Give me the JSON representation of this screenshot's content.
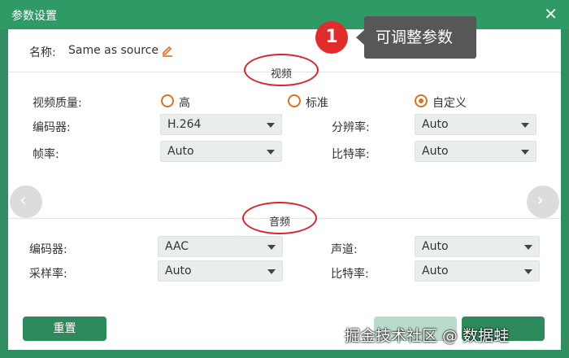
{
  "window": {
    "title": "参数设置",
    "close_glyph": "✕"
  },
  "name": {
    "label": "名称:",
    "value": "Same as source",
    "edit_icon": "pencil-icon"
  },
  "callout": {
    "number": "1",
    "text": "可调整参数"
  },
  "video": {
    "section_title": "视频",
    "quality_label": "视频质量:",
    "quality_options": [
      {
        "label": "高",
        "checked": false
      },
      {
        "label": "标准",
        "checked": false
      },
      {
        "label": "自定义",
        "checked": true
      }
    ],
    "encoder_label": "编码器:",
    "encoder_value": "H.264",
    "resolution_label": "分辨率:",
    "resolution_value": "Auto",
    "framerate_label": "帧率:",
    "framerate_value": "Auto",
    "bitrate_label": "比特率:",
    "bitrate_value": "Auto"
  },
  "audio": {
    "section_title": "音频",
    "encoder_label": "编码器:",
    "encoder_value": "AAC",
    "channel_label": "声道:",
    "channel_value": "Auto",
    "samplerate_label": "采样率:",
    "samplerate_value": "Auto",
    "bitrate_label": "比特率:",
    "bitrate_value": "Auto"
  },
  "nav": {
    "prev_glyph": "‹",
    "next_glyph": "›"
  },
  "footer": {
    "reset_label": "重置"
  },
  "watermark": "掘金技术社区 @ 数据蛙",
  "colors": {
    "accent": "#2e8a5c",
    "radio": "#e07020",
    "highlight": "#d9242b",
    "badge": "#e22b2b"
  }
}
